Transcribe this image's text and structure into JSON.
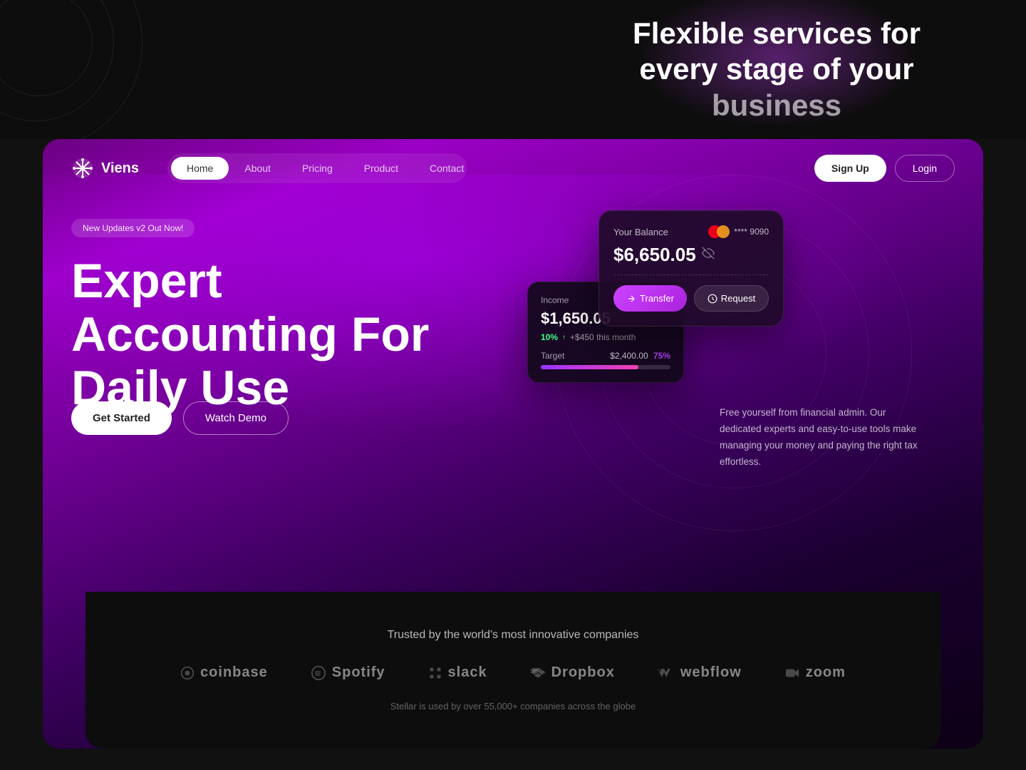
{
  "topSection": {
    "heading": "Flexible services for every stage of your business",
    "headingDimPart": "business"
  },
  "navbar": {
    "logo": "Viens",
    "links": [
      {
        "label": "Home",
        "active": true
      },
      {
        "label": "About",
        "active": false
      },
      {
        "label": "Pricing",
        "active": false
      },
      {
        "label": "Product",
        "active": false
      },
      {
        "label": "Contact",
        "active": false
      }
    ],
    "signupLabel": "Sign Up",
    "loginLabel": "Login"
  },
  "hero": {
    "badge": "New Updates v2 Out Now!",
    "title": "Expert Accounting For Daily Use",
    "titleLine1": "Expert",
    "titleLine2": "Accounting For",
    "titleLine3": "Daily Use",
    "description": "Free yourself from financial admin. Our dedicated experts and easy-to-use tools make managing your money and paying the right tax effortless.",
    "ctaPrimary": "Get Started",
    "ctaSecondary": "Watch Demo"
  },
  "balanceCard": {
    "label": "Your Balance",
    "cardNumber": "**** 9090",
    "amount": "$6,650.05",
    "transferBtn": "Transfer",
    "requestBtn": "Request"
  },
  "incomeCard": {
    "label": "Income",
    "amount": "$1,650.05",
    "percentage": "10%",
    "change": "+$450 this month",
    "targetLabel": "Target",
    "targetAmount": "$2,400.00",
    "targetPct": "75%",
    "progressWidth": "75"
  },
  "bottomSection": {
    "trustedHeading": "Trusted by the world's most innovative companies",
    "brands": [
      {
        "name": "coinbase",
        "label": "coinbase"
      },
      {
        "name": "spotify",
        "label": "Spotify"
      },
      {
        "name": "slack",
        "label": "slack"
      },
      {
        "name": "dropbox",
        "label": "Dropbox"
      },
      {
        "name": "webflow",
        "label": "webflow"
      },
      {
        "name": "zoom",
        "label": "zoom"
      }
    ],
    "footerNote": "Stellar is used by over 55,000+ companies across the globe"
  },
  "icons": {
    "snowflake": "✳",
    "eye": "👁",
    "arrowUp": "↗",
    "send": "↗",
    "download": "↙"
  }
}
